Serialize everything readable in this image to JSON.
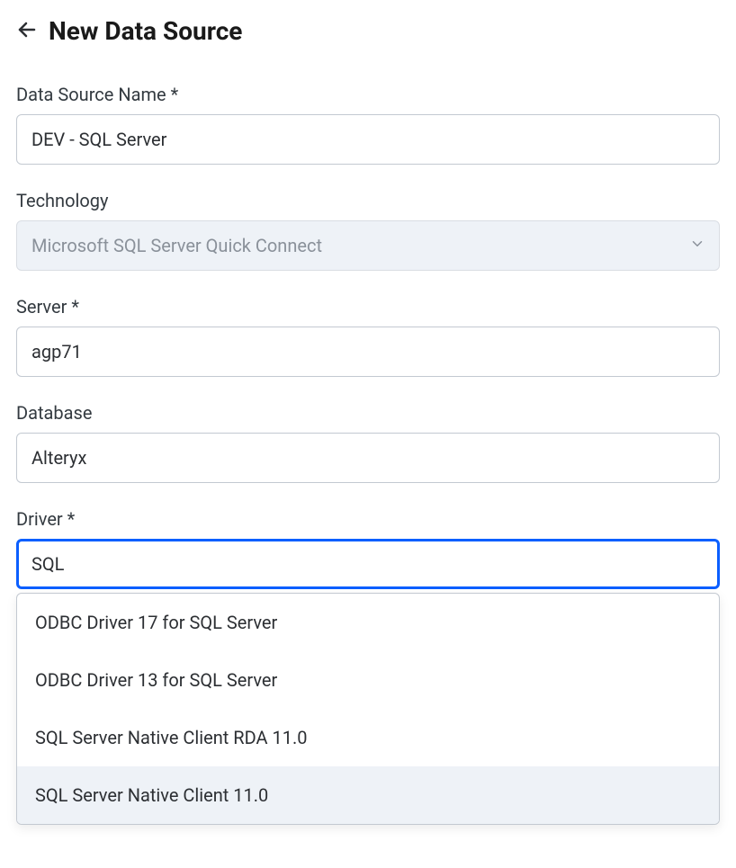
{
  "header": {
    "title": "New Data Source"
  },
  "form": {
    "dataSourceName": {
      "label": "Data Source Name *",
      "value": "DEV - SQL Server"
    },
    "technology": {
      "label": "Technology",
      "value": "Microsoft SQL Server Quick Connect"
    },
    "server": {
      "label": "Server *",
      "value": "agp71"
    },
    "database": {
      "label": "Database",
      "value": "Alteryx"
    },
    "driver": {
      "label": "Driver *",
      "value": "SQL",
      "options": [
        "ODBC Driver 17 for SQL Server",
        "ODBC Driver 13 for SQL Server",
        "SQL Server Native Client RDA 11.0",
        "SQL Server Native Client 11.0"
      ],
      "highlightedIndex": 3
    }
  }
}
